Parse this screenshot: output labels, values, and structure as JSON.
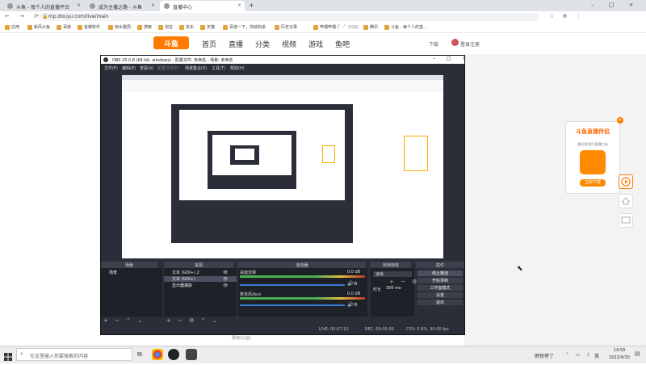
{
  "browser": {
    "tabs": [
      {
        "title": "斗鱼 - 每个人的直播平台",
        "active": false
      },
      {
        "title": "成为主播之路 - 斗鱼",
        "active": false
      },
      {
        "title": "直播中心",
        "active": true
      }
    ],
    "new_tab_label": "+",
    "url": "mp.douyu.com/live/main",
    "bookmarks": [
      "应用",
      "斯风大鱼",
      "百度",
      "金蝶软件",
      "雨水整局",
      "搜索",
      "淘宝",
      "京东",
      "天猫",
      "百度一下，你就知道",
      "历史记录",
      "哔哩哔哩 (゜-゜)つロ",
      "腾讯",
      "斗鱼 - 每个人的直..."
    ]
  },
  "site": {
    "logo": "斗鱼",
    "nav": [
      "首页",
      "直播",
      "分类",
      "视频",
      "游戏",
      "鱼吧"
    ],
    "download": "下载",
    "user": "登录注册",
    "bottom_text": "费用(公益)",
    "promo": {
      "title": "斗鱼直播伴侣",
      "subtitle": "超好用电PC直播工具",
      "button": "立即下载"
    }
  },
  "obs": {
    "title": "OBS 25.0.8 (64-bit, windows) - 配置文件: 未命名 - 场景: 未命名",
    "menu": [
      "文件(F)",
      "编辑(E)",
      "查看(V)",
      "配置文件(P)",
      "场景集合(S)",
      "工具(T)",
      "帮助(H)"
    ],
    "docks": {
      "scenes": "场景",
      "sources": "来源",
      "mixer": "混音器",
      "transitions": "转场特效",
      "controls": "控件"
    },
    "scene_list": [
      "场景"
    ],
    "source_list": [
      "文本 (GDI+) 2",
      "文本 (GDI+)",
      "显示器捕获"
    ],
    "mixer_tracks": [
      {
        "name": "桌面音频",
        "level": "0.0 dB"
      },
      {
        "name": "麦克风/Aux",
        "level": "0.0 dB"
      }
    ],
    "transition": {
      "type": "淡出",
      "duration_label": "时长",
      "duration": "300 ms"
    },
    "controls": [
      "停止推流",
      "开始录制",
      "工作室模式",
      "设置",
      "退出"
    ],
    "status": {
      "live": "LIVE: 00:07:10",
      "rec": "REC: 00:00:00",
      "cpu": "CPU: 5.9%, 30.00 fps"
    }
  },
  "taskbar": {
    "search_placeholder": "在这里输入你要搜索的内容",
    "weather": "雨快停了",
    "ime": "英",
    "time": "14:59",
    "date": "2022/4/30"
  }
}
